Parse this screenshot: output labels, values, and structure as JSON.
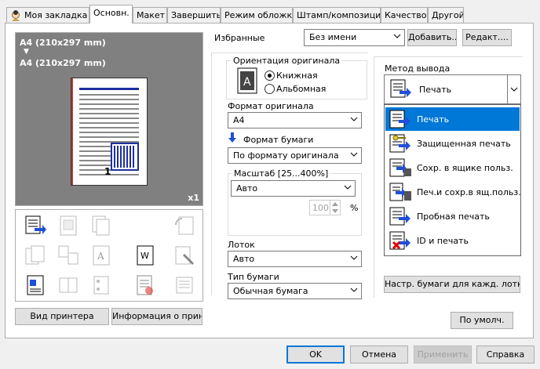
{
  "tabs": [
    {
      "label": "Моя закладка"
    },
    {
      "label": "Основн."
    },
    {
      "label": "Макет"
    },
    {
      "label": "Завершить"
    },
    {
      "label": "Режим обложки"
    },
    {
      "label": "Штамп/композиция"
    },
    {
      "label": "Качество"
    },
    {
      "label": "Другой"
    }
  ],
  "preview": {
    "line1": "A4 (210x297 mm)",
    "arrow": "▼",
    "line2": "A4 (210x297 mm)",
    "copies": "x1",
    "page_number": "1"
  },
  "left_buttons": {
    "printer_view": "Вид принтера",
    "printer_info": "Информация о принт."
  },
  "favorites": {
    "label": "Избранные",
    "value": "Без имени",
    "add": "Добавить...",
    "edit": "Редакт...."
  },
  "orientation": {
    "title": "Ориентация оригинала",
    "portrait": "Книжная",
    "landscape": "Альбомная",
    "selected": "portrait"
  },
  "original_size": {
    "label": "Формат оригинала",
    "value": "A4"
  },
  "paper_size": {
    "label": "Формат бумаги",
    "value": "По формату оригинала"
  },
  "zoom": {
    "title": "Масштаб [25...400%]",
    "value": "Авто",
    "number": "100",
    "unit": "%"
  },
  "tray": {
    "label": "Лоток",
    "value": "Авто"
  },
  "paper_type": {
    "label": "Тип бумаги",
    "value": "Обычная бумага"
  },
  "output_method": {
    "label": "Метод вывода",
    "value": "Печать",
    "options": [
      {
        "label": "Печать",
        "icon": "print-icon"
      },
      {
        "label": "Защищенная печать",
        "icon": "secure-print-icon"
      },
      {
        "label": "Сохр. в ящике польз.",
        "icon": "save-box-icon"
      },
      {
        "label": "Печ.и сохр.в ящ.польз.",
        "icon": "print-save-box-icon"
      },
      {
        "label": "Пробная печать",
        "icon": "proof-print-icon"
      },
      {
        "label": "ID и печать",
        "icon": "id-print-icon"
      }
    ],
    "selected_index": 0
  },
  "paper_per_tray_button": "Настр. бумаги для кажд. лотка...",
  "defaults_button": "По умолч.",
  "footer": {
    "ok": "OK",
    "cancel": "Отмена",
    "apply": "Применить",
    "help": "Справка"
  },
  "colors": {
    "accent": "#0078d7",
    "preview_bg": "#808080",
    "dialog_bg": "#f0f0f0"
  }
}
